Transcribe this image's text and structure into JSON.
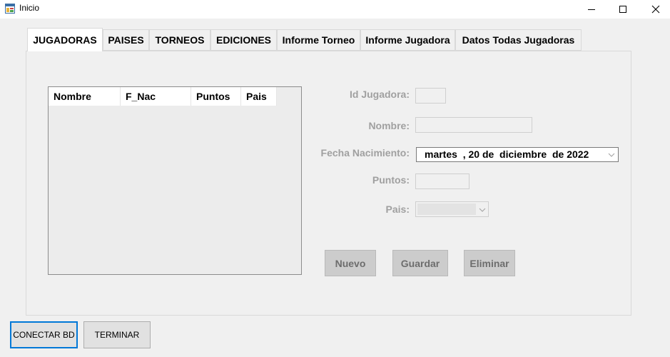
{
  "window": {
    "title": "Inicio",
    "icons": {
      "app": "windows-form-icon",
      "minimize": "minimize-icon",
      "maximize": "maximize-icon",
      "close": "close-icon"
    }
  },
  "tabs": [
    {
      "label": "JUGADORAS",
      "active": true
    },
    {
      "label": "PAISES"
    },
    {
      "label": "TORNEOS"
    },
    {
      "label": "EDICIONES"
    },
    {
      "label": "Informe Torneo"
    },
    {
      "label": "Informe Jugadora"
    },
    {
      "label": "Datos Todas Jugadoras"
    }
  ],
  "grid": {
    "columns": [
      "Nombre",
      "F_Nac",
      "Puntos",
      "Pais"
    ],
    "rows": []
  },
  "form": {
    "id_label": "Id Jugadora:",
    "id_value": "",
    "nombre_label": "Nombre:",
    "nombre_value": "",
    "fecha_label": "Fecha Nacimiento:",
    "fecha_value": "martes  , 20 de  diciembre  de 2022",
    "puntos_label": "Puntos:",
    "puntos_value": "",
    "pais_label": "Pais:",
    "pais_value": ""
  },
  "actions": {
    "nuevo": "Nuevo",
    "guardar": "Guardar",
    "eliminar": "Eliminar"
  },
  "bottom": {
    "conectar": "CONECTAR BD",
    "terminar": "TERMINAR"
  },
  "colors": {
    "focus_border": "#0078d7",
    "disabled_text": "#a0a0a0",
    "button_disabled_bg": "#cccccc"
  }
}
